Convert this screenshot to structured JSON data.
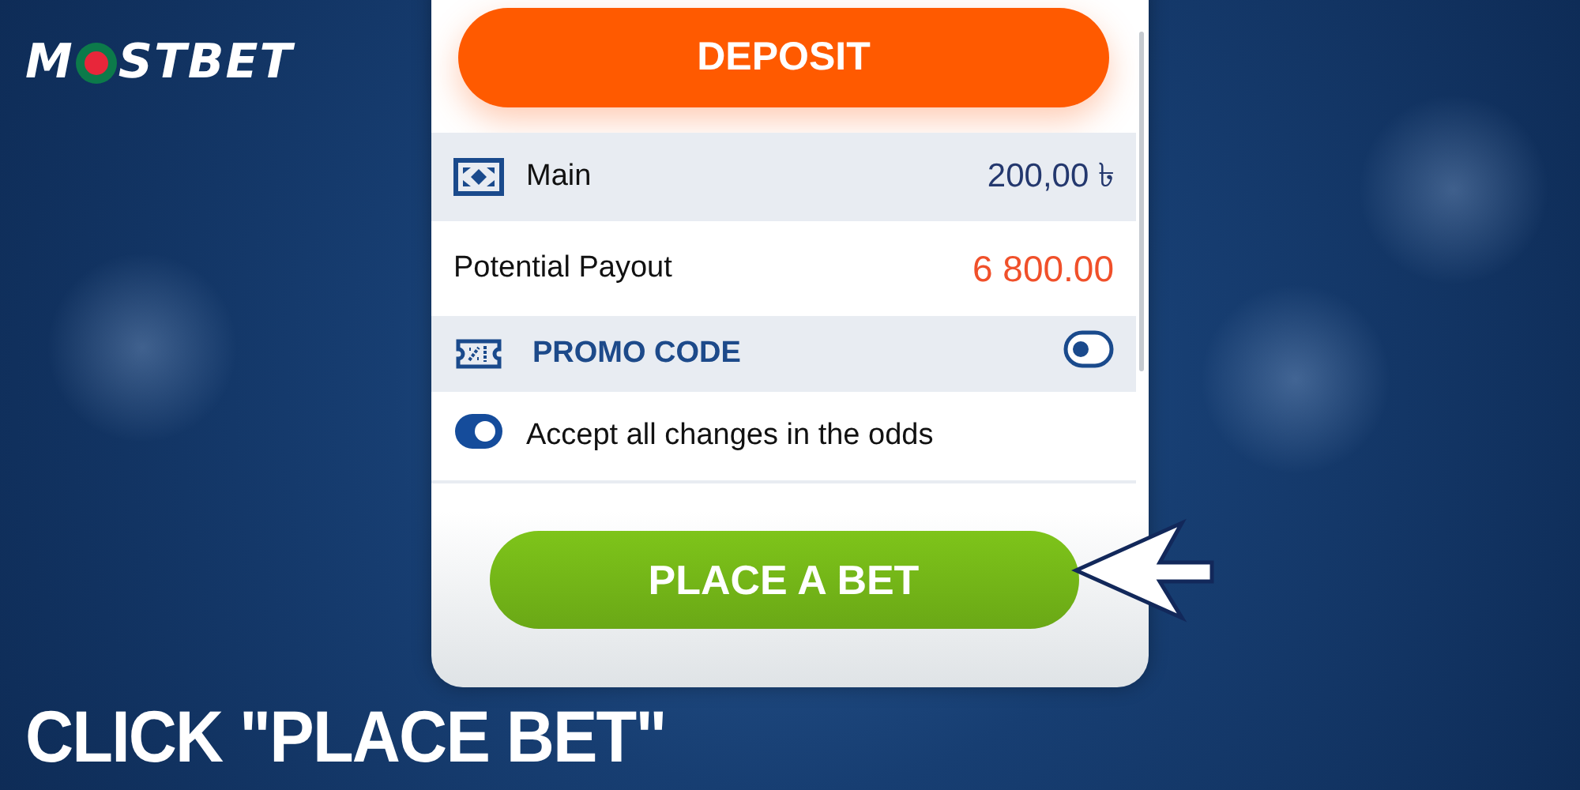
{
  "logo": {
    "before": "M",
    "after": "STBET"
  },
  "bet_slip": {
    "deposit_button": "DEPOSIT",
    "balance": {
      "label": "Main",
      "amount": "200,00 ৳"
    },
    "payout": {
      "label": "Potential Payout",
      "amount": "6 800.00"
    },
    "options": [
      {
        "kind": "promo",
        "label": "PROMO CODE",
        "on": false
      },
      {
        "kind": "accept",
        "label": "Accept all changes in the odds",
        "on": true
      }
    ],
    "place_bet_button": "PLACE A BET"
  },
  "headline": "CLICK \"PLACE BET\""
}
